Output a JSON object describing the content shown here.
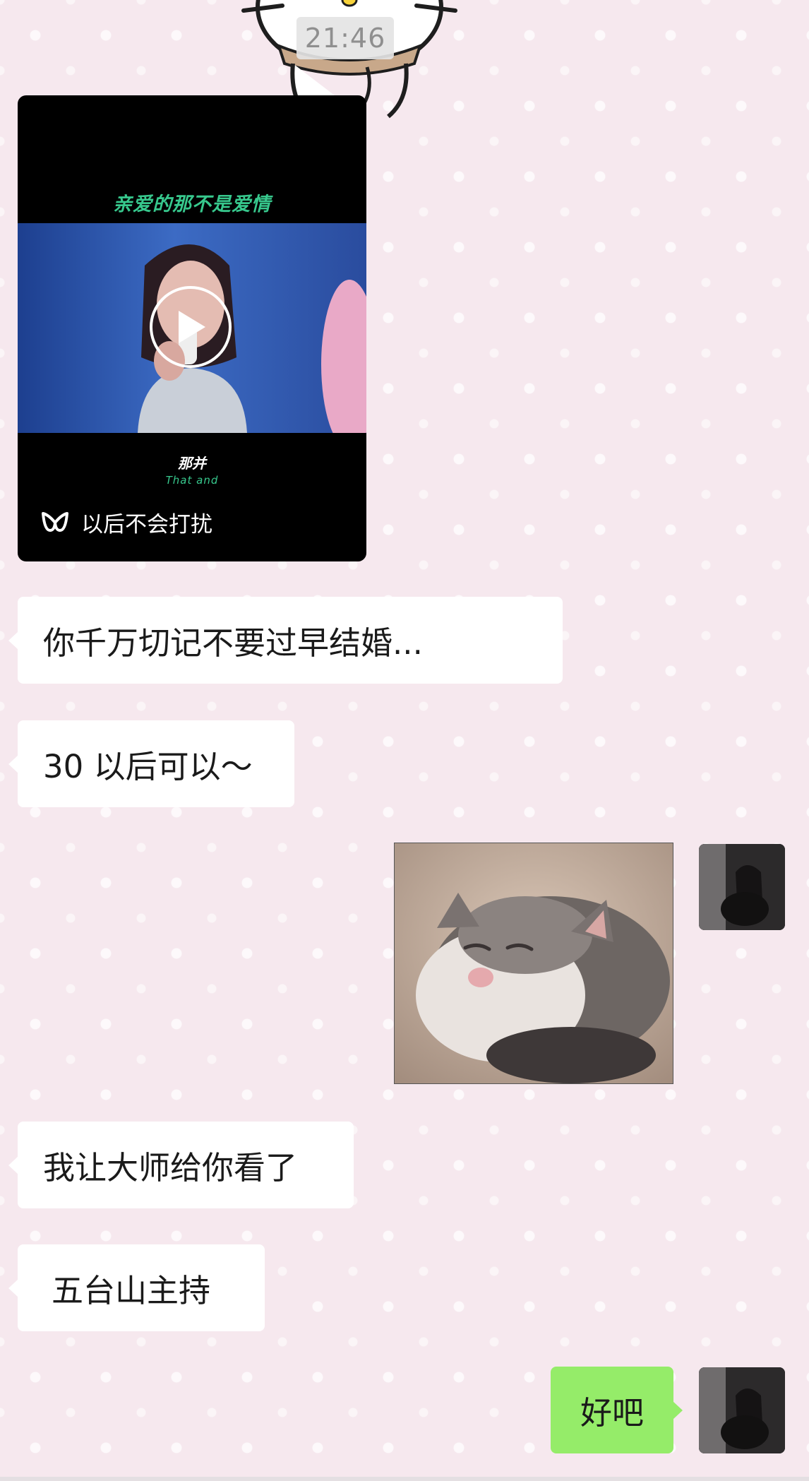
{
  "chat": {
    "timestamp": "21:46",
    "video": {
      "caption": "亲爱的那不是爱情",
      "subtitle_cn": "那并",
      "subtitle_en": "That and",
      "source_label": "以后不会打扰",
      "source_icon": "wechat-channels-icon",
      "play_icon": "play-icon"
    },
    "messages": [
      {
        "side": "left",
        "text": "你千万切记不要过早结婚..."
      },
      {
        "side": "left",
        "text": "30 以后可以～"
      },
      {
        "side": "right",
        "type": "image",
        "content": "sleeping-kitten-sticker"
      },
      {
        "side": "left",
        "text": "我让大师给你看了"
      },
      {
        "side": "left",
        "text": "五台山主持"
      },
      {
        "side": "right",
        "text": "好吧"
      }
    ]
  },
  "colors": {
    "background": "#f6e8ee",
    "incoming_bubble": "#ffffff",
    "outgoing_bubble": "#95ec69",
    "timestamp_bg": "#e4e4e4",
    "video_caption": "#37c88d"
  }
}
